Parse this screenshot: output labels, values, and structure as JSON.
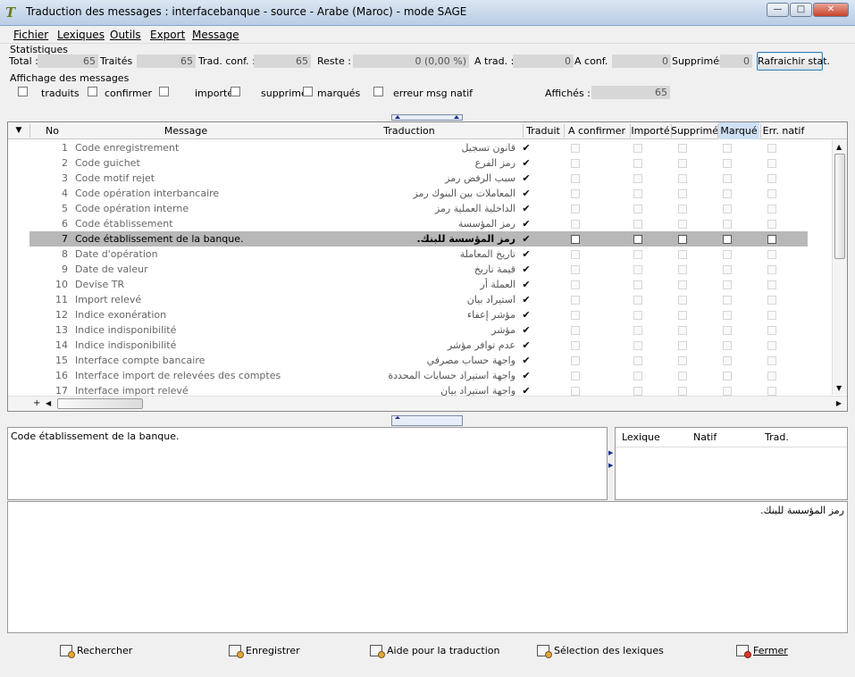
{
  "window": {
    "title": "Traduction des messages : interfacebanque - source - Arabe (Maroc) - mode SAGE",
    "minimize": "—",
    "maximize": "□",
    "close": "✕"
  },
  "menu": [
    "Fichier",
    "Lexiques",
    "Outils",
    "Export",
    "Message"
  ],
  "stats": {
    "group_label": "Statistiques",
    "total_label": "Total :",
    "total_value": "65",
    "traites_label": "Traités :",
    "traites_value": "65",
    "tradconf_label": "Trad. conf. :",
    "tradconf_value": "65",
    "reste_label": "Reste :",
    "reste_value": "0 (0,00 %)",
    "atrad_label": "A trad. :",
    "atrad_value": "0",
    "aconf_label": "A conf. :",
    "aconf_value": "0",
    "supprimes_label": "Supprimés :",
    "supprimes_value": "0",
    "refresh_button": "Rafraichir stat."
  },
  "filters": {
    "group_label": "Affichage des messages",
    "items": [
      "traduits",
      "confirmer",
      "importés",
      "supprimés",
      "marqués",
      "erreur msg natif"
    ],
    "affiches_label": "Affichés :",
    "affiches_value": "65"
  },
  "grid": {
    "columns": [
      "No",
      "Message",
      "Traduction",
      "Traduit",
      "A confirmer",
      "Importé",
      "Supprimé",
      "Marqué",
      "Err. natif"
    ],
    "check_glyph": "✔",
    "selected_index": 6,
    "rows": [
      {
        "no": "1",
        "message": "Code enregistrement",
        "traduction": "قانون تسجيل"
      },
      {
        "no": "2",
        "message": "Code guichet",
        "traduction": "رمز الفرع"
      },
      {
        "no": "3",
        "message": "Code motif rejet",
        "traduction": "سبب الرفض رمز"
      },
      {
        "no": "4",
        "message": "Code opération interbancaire",
        "traduction": "المعاملات بين البنوك رمز"
      },
      {
        "no": "5",
        "message": "Code opération interne",
        "traduction": "الداخلية العملية رمز"
      },
      {
        "no": "6",
        "message": "Code établissement",
        "traduction": "رمز المؤسسة"
      },
      {
        "no": "7",
        "message": "Code établissement de la banque.",
        "traduction": "رمز المؤسسة للبنك."
      },
      {
        "no": "8",
        "message": "Date d'opération",
        "traduction": "تاريخ المعاملة"
      },
      {
        "no": "9",
        "message": "Date de valeur",
        "traduction": "قيمة تاريخ"
      },
      {
        "no": "10",
        "message": "Devise TR",
        "traduction": "العملة أر"
      },
      {
        "no": "11",
        "message": "Import relevé",
        "traduction": "استيراد بيان"
      },
      {
        "no": "12",
        "message": "Indice exonération",
        "traduction": "مؤشر إعفاء"
      },
      {
        "no": "13",
        "message": "Indice indisponibilité",
        "traduction": "مؤشر"
      },
      {
        "no": "14",
        "message": "Indice indisponibilité",
        "traduction": "عدم توافر مؤشر"
      },
      {
        "no": "15",
        "message": "Interface compte bancaire",
        "traduction": "واجهة حساب مصرفي"
      },
      {
        "no": "16",
        "message": "Interface import de relevées des comptes",
        "traduction": "واجهة استيراد حسابات المحددة"
      },
      {
        "no": "17",
        "message": "Interface import relevé",
        "traduction": "واجهة استيراد بيان"
      }
    ]
  },
  "source_text": "Code établissement de la banque.",
  "lexique_columns": [
    "Lexique",
    "Natif",
    "Trad."
  ],
  "translation_text": "رمز المؤسسة للبنك.",
  "footer": [
    "Rechercher",
    "Enregistrer",
    "Aide pour la traduction",
    "Sélection des lexiques",
    "Fermer"
  ]
}
